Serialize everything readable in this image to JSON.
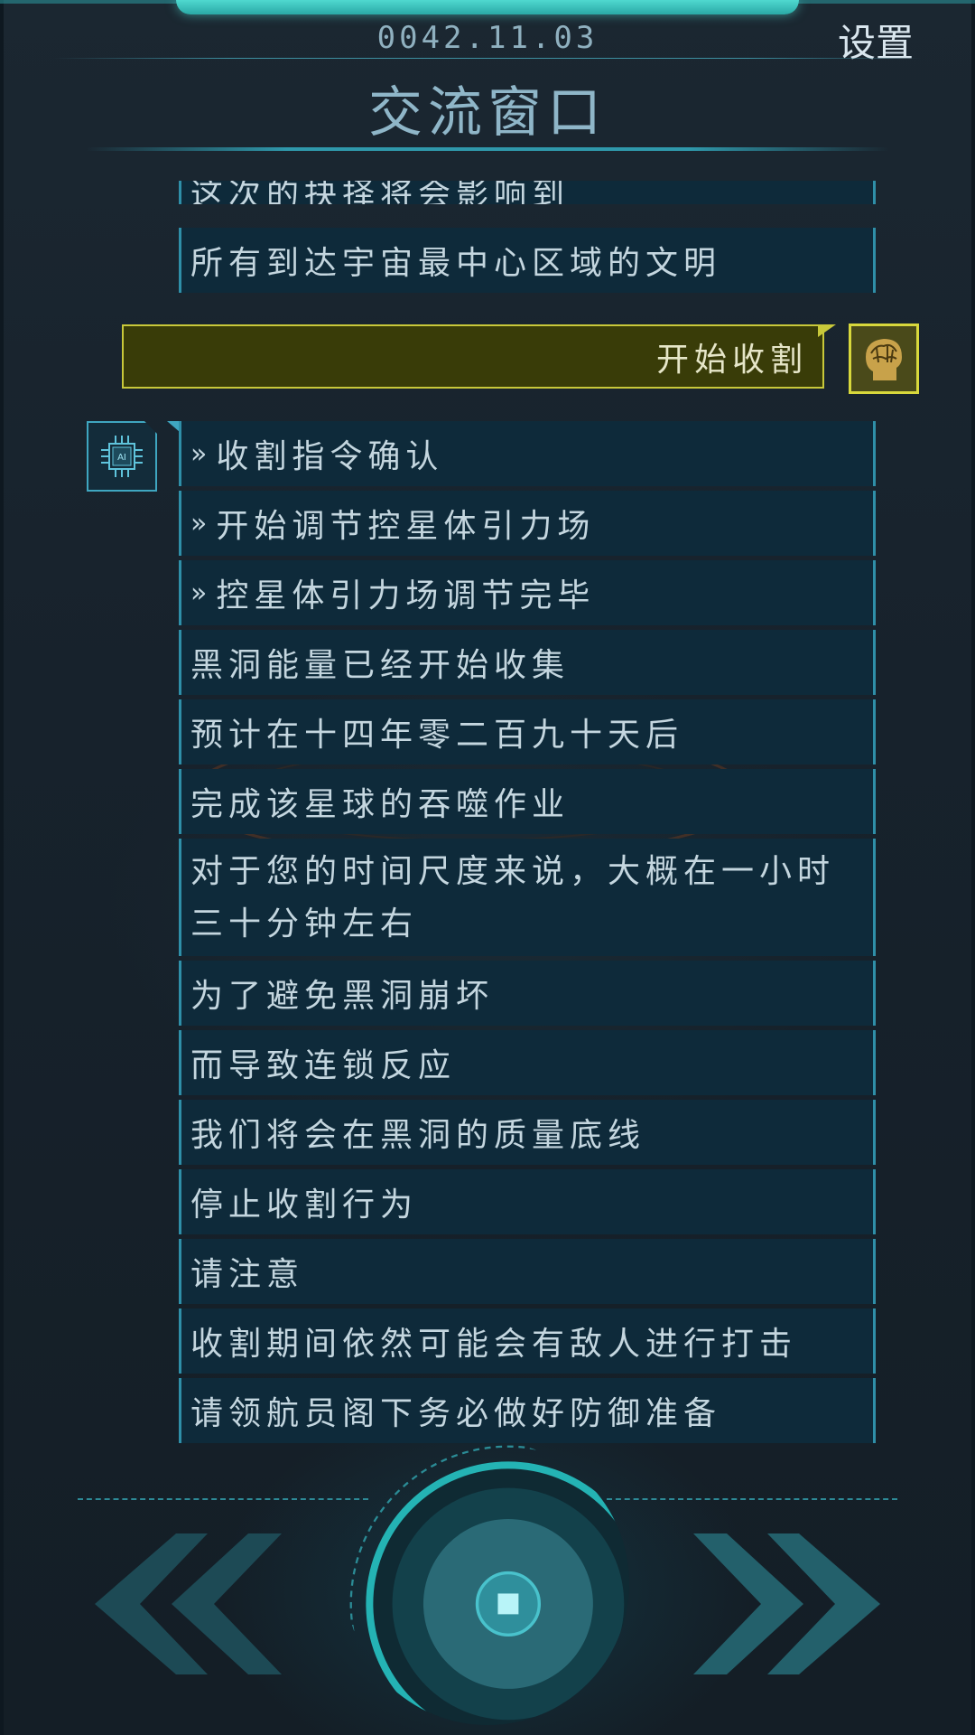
{
  "header": {
    "date": "0042.11.03",
    "settings_label": "设置",
    "title": "交流窗口"
  },
  "conversation": {
    "ai_messages_top": [
      "这次的抉择将会影响到",
      "所有到达宇宙最中心区域的文明"
    ],
    "user_message": "开始收割",
    "ai_messages": [
      {
        "prefix": "»",
        "text": "收割指令确认"
      },
      {
        "prefix": "»",
        "text": "开始调节控星体引力场"
      },
      {
        "prefix": "»",
        "text": "控星体引力场调节完毕"
      },
      {
        "prefix": "",
        "text": "黑洞能量已经开始收集"
      },
      {
        "prefix": "",
        "text": "预计在十四年零二百九十天后"
      },
      {
        "prefix": "",
        "text": "完成该星球的吞噬作业"
      },
      {
        "prefix": "",
        "text": "对于您的时间尺度来说，大概在一小时三十分钟左右"
      },
      {
        "prefix": "",
        "text": "为了避免黑洞崩坏"
      },
      {
        "prefix": "",
        "text": "而导致连锁反应"
      },
      {
        "prefix": "",
        "text": "我们将会在黑洞的质量底线"
      },
      {
        "prefix": "",
        "text": "停止收割行为"
      },
      {
        "prefix": "",
        "text": "请注意"
      },
      {
        "prefix": "",
        "text": "收割期间依然可能会有敌人进行打击"
      },
      {
        "prefix": "",
        "text": "请领航员阁下务必做好防御准备"
      }
    ],
    "ai_avatar_label": "AI"
  },
  "controls": {
    "prev_icon": "double-chevron-left-icon",
    "center_icon": "stop-square-icon",
    "next_icon": "double-chevron-right-icon"
  },
  "colors": {
    "accent": "#2f98ab",
    "user_bubble": "#393c08",
    "user_border": "#c8c83a",
    "ai_bubble": "#0e2a3a"
  }
}
